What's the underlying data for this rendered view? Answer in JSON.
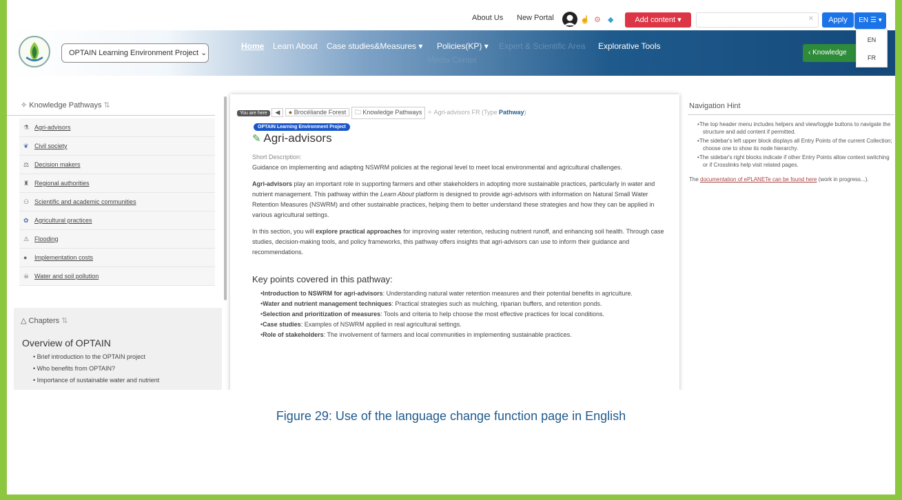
{
  "topbar": {
    "about": "About Us",
    "portal": "New Portal",
    "add_content": "Add content",
    "apply": "Apply",
    "lang_current": "EN"
  },
  "lang_menu": [
    "EN",
    "FR"
  ],
  "project_select": "OPTAIN Learning Environment Project",
  "nav": {
    "home": "Home",
    "learn": "Learn About",
    "case": "Case studies&Measures",
    "policies": "Policies(KP)",
    "expert": "Expert & Scientific Area",
    "tools": "Explorative Tools",
    "media": "Media Center",
    "knowledge_btn": "Knowledge"
  },
  "sidebar": {
    "title": "Knowledge Pathways",
    "items": [
      {
        "label": "Agri-advisors",
        "icon": "advisor-icon"
      },
      {
        "label": "Civil society",
        "icon": "bird-icon"
      },
      {
        "label": "Decision makers",
        "icon": "scale-icon"
      },
      {
        "label": "Regional authorities",
        "icon": "building-icon"
      },
      {
        "label": "Scientific and academic communities",
        "icon": "people-icon"
      },
      {
        "label": "Agricultural practices",
        "icon": "leaf-icon"
      },
      {
        "label": "Flooding",
        "icon": "flood-icon"
      },
      {
        "label": "Implementation costs",
        "icon": "coins-icon"
      },
      {
        "label": "Water and soil pollution",
        "icon": "pollution-icon"
      }
    ]
  },
  "chapters": {
    "title": "Chapters",
    "section": "Overview of OPTAIN",
    "items": [
      "Brief introduction to the OPTAIN project",
      "Who benefits from OPTAIN?",
      "Importance of sustainable water and nutrient"
    ]
  },
  "breadcrumb": {
    "you_are_here": "You are here",
    "forest": "Brocéliande Forest",
    "pathways": "Knowledge Pathways",
    "current": "Agri-advisors FR (Type",
    "type": "Pathway"
  },
  "main": {
    "project_badge": "OPTAIN Learning Environment Project",
    "title": "Agri-advisors",
    "short_label": "Short Description:",
    "short_text": "Guidance on implementing and adapting NSWRM policies at the regional level to meet local environmental and agricultural challenges.",
    "para1_bold": "Agri-advisors",
    "para1_a": " play an important role in supporting farmers and other stakeholders in adopting more sustainable practices, particularly in water and nutrient management. This pathway within the ",
    "para1_italic": "Learn About",
    "para1_b": " platform is designed to provide agri-advisors with information on Natural Small Water Retention Measures (NSWRM) and other sustainable practices, helping them to better understand these strategies and how they can be applied in various agricultural settings.",
    "para2_a": "In this section, you will ",
    "para2_bold": "explore practical approaches",
    "para2_b": " for improving water retention, reducing nutrient runoff, and enhancing soil health. Through case studies, decision-making tools, and policy frameworks, this pathway offers insights that agri-advisors can use to inform their guidance and recommendations.",
    "key_title": "Key points covered in this pathway:",
    "key_points": [
      {
        "bold": "Introduction to NSWRM for agri-advisors",
        "text": ": Understanding natural water retention measures and their potential benefits in agriculture."
      },
      {
        "bold": "Water and nutrient management techniques",
        "text": ": Practical strategies such as mulching, riparian buffers, and retention ponds."
      },
      {
        "bold": "Selection and prioritization of measures",
        "text": ": Tools and criteria to help choose the most effective practices for local conditions."
      },
      {
        "bold": "Case studies",
        "text": ": Examples of NSWRM applied in real agricultural settings."
      },
      {
        "bold": "Role of stakeholders",
        "text": ": The involvement of farmers and local communities in implementing sustainable practices."
      }
    ]
  },
  "hint": {
    "title": "Navigation Hint",
    "items": [
      "The top header menu includes helpers and view/toggle buttons to navigate the structure and add content if permitted.",
      "The sidebar's left upper block displays all Entry Points of the current Collection; choose one to show its node hierarchy.",
      "The sidebar's right blocks indicate if other Entry Points allow context switching or if Crosslinks help visit related pages."
    ],
    "doc_pre": "The ",
    "doc_link": "documentation of ePLANETe can be found here",
    "doc_post": " (work in progress...)."
  },
  "caption": "Figure 29: Use of the language change function page in English"
}
